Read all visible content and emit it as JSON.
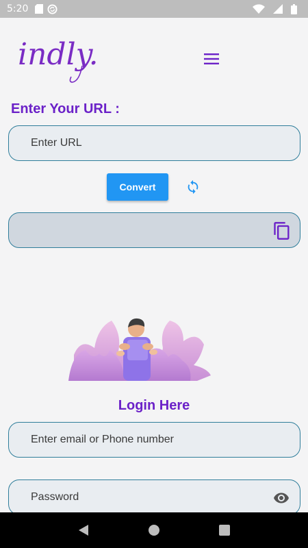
{
  "status_bar": {
    "time": "5:20",
    "icons": [
      "sd-card-icon",
      "sync-circle-icon",
      "wifi-icon",
      "signal-icon",
      "battery-icon"
    ]
  },
  "app_bar": {
    "logo_text": "indly.",
    "menu_icon": "hamburger-menu-icon"
  },
  "url_section": {
    "title": "Enter Your URL :",
    "url_placeholder": "Enter URL",
    "convert_label": "Convert",
    "refresh_icon": "refresh-icon",
    "result_value": "",
    "copy_icon": "copy-icon"
  },
  "login_section": {
    "title": "Login Here",
    "email_placeholder": "Enter email or Phone number",
    "password_placeholder": "Password",
    "eye_icon": "visibility-icon"
  },
  "colors": {
    "accent_purple": "#6b21c8",
    "button_blue": "#2196f3",
    "field_border": "#2e7d9a",
    "field_bg": "#e9edf1",
    "result_bg": "#d0d7df"
  },
  "nav_bar": {
    "buttons": [
      "back-icon",
      "home-icon",
      "recents-icon"
    ]
  }
}
